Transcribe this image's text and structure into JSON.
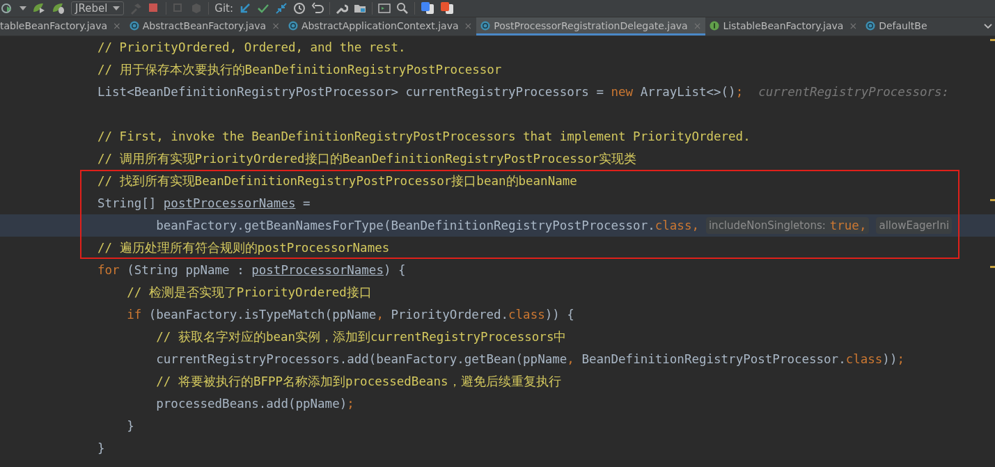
{
  "toolbar": {
    "vcs_profile": "JRebel",
    "git_label": "Git:"
  },
  "tabs": [
    {
      "label": "tableBeanFactory.java",
      "selected": false,
      "close": "×"
    },
    {
      "label": "AbstractBeanFactory.java",
      "kind": "class",
      "selected": false,
      "close": "×"
    },
    {
      "label": "AbstractApplicationContext.java",
      "kind": "class",
      "selected": false,
      "close": "×"
    },
    {
      "label": "PostProcessorRegistrationDelegate.java",
      "kind": "class",
      "selected": true,
      "close": "×"
    },
    {
      "label": "ListableBeanFactory.java",
      "kind": "interface",
      "selected": false,
      "close": "×"
    },
    {
      "label": "DefaultBe",
      "kind": "class",
      "selected": false
    }
  ],
  "lines": [
    {
      "current": false,
      "boxed": false,
      "segments": [
        {
          "kind": "comment",
          "text": "// PriorityOrdered, Ordered, and the rest."
        }
      ]
    },
    {
      "current": false,
      "boxed": false,
      "segments": [
        {
          "kind": "comment",
          "text": "// 用于保存本次要执行的BeanDefinitionRegistryPostProcessor"
        }
      ]
    },
    {
      "current": false,
      "boxed": false,
      "segments": [
        {
          "kind": "code",
          "text": "List<BeanDefinitionRegistryPostProcessor> currentRegistryProcessors = "
        },
        {
          "kind": "keyword",
          "text": "new"
        },
        {
          "kind": "code",
          "text": " ArrayList<>()"
        },
        {
          "kind": "keyword",
          "text": ";"
        },
        {
          "kind": "hint",
          "text": "currentRegistryProcessors:"
        }
      ]
    },
    {
      "current": false,
      "boxed": false
    },
    {
      "current": false,
      "boxed": false,
      "segments": [
        {
          "kind": "comment",
          "text": "// First, invoke the BeanDefinitionRegistryPostProcessors that implement PriorityOrdered."
        }
      ]
    },
    {
      "current": false,
      "boxed": false,
      "segments": [
        {
          "kind": "comment",
          "text": "// 调用所有实现PriorityOrdered接口的BeanDefinitionRegistryPostProcessor实现类"
        }
      ]
    },
    {
      "current": false,
      "boxed": true,
      "segments": [
        {
          "kind": "comment",
          "text": "// 找到所有实现BeanDefinitionRegistryPostProcessor接口bean的beanName"
        }
      ]
    },
    {
      "current": false,
      "boxed": true,
      "segments": [
        {
          "kind": "code",
          "text": "String[] "
        },
        {
          "kind": "field",
          "text": "postProcessorNames"
        },
        {
          "kind": "code",
          "text": " ="
        }
      ],
      "children": [
        {
          "kind": "continuation",
          "current": true,
          "boxed": true,
          "segments": [
            {
              "kind": "code",
              "text": "beanFactory.getBeanNamesForType(BeanDefinitionRegistryPostProcessor."
            },
            {
              "kind": "keyword",
              "text": "class,"
            },
            {
              "kind": "inlay",
              "text": "includeNonSingletons:",
              "value": "true,"
            },
            {
              "kind": "inlay",
              "text": "allowEagerIni"
            }
          ]
        }
      ]
    },
    {
      "current": false,
      "boxed": true,
      "segments": [
        {
          "kind": "comment",
          "text": "// 遍历处理所有符合规则的postProcessorNames"
        }
      ]
    },
    {
      "current": false,
      "boxed": false,
      "segments": [
        {
          "kind": "keyword",
          "text": "for"
        },
        {
          "kind": "code",
          "text": " (String ppName : "
        },
        {
          "kind": "field",
          "text": "postProcessorNames"
        },
        {
          "kind": "code",
          "text": ") {"
        }
      ],
      "children": [
        {
          "current": false,
          "boxed": false,
          "segments": [
            {
              "kind": "comment",
              "text": "// 检测是否实现了PriorityOrdered接口"
            }
          ]
        },
        {
          "current": false,
          "boxed": false,
          "segments": [
            {
              "kind": "keyword",
              "text": "if"
            },
            {
              "kind": "code",
              "text": " (beanFactory.isTypeMatch(ppName"
            },
            {
              "kind": "keyword",
              "text": ","
            },
            {
              "kind": "code",
              "text": " PriorityOrdered."
            },
            {
              "kind": "keyword",
              "text": "class"
            },
            {
              "kind": "code",
              "text": ")) {"
            }
          ],
          "children": [
            {
              "current": false,
              "boxed": false,
              "segments": [
                {
                  "kind": "comment",
                  "text": "// 获取名字对应的bean实例，添加到currentRegistryProcessors中"
                }
              ]
            },
            {
              "current": false,
              "boxed": false,
              "segments": [
                {
                  "kind": "code",
                  "text": "currentRegistryProcessors.add(beanFactory.getBean(ppName"
                },
                {
                  "kind": "keyword",
                  "text": ","
                },
                {
                  "kind": "code",
                  "text": " BeanDefinitionRegistryPostProcessor."
                },
                {
                  "kind": "keyword",
                  "text": "class"
                },
                {
                  "kind": "code",
                  "text": "))"
                },
                {
                  "kind": "keyword",
                  "text": ";"
                }
              ]
            },
            {
              "current": false,
              "boxed": false,
              "segments": [
                {
                  "kind": "comment",
                  "text": "// 将要被执行的BFPP名称添加到processedBeans，避免后续重复执行"
                }
              ]
            },
            {
              "current": false,
              "boxed": false,
              "segments": [
                {
                  "kind": "code",
                  "text": "processedBeans.add(ppName)"
                },
                {
                  "kind": "keyword",
                  "text": ";"
                }
              ]
            }
          ]
        },
        {
          "current": false,
          "boxed": false,
          "segments": [
            {
              "kind": "code",
              "text": "}"
            }
          ]
        }
      ]
    },
    {
      "current": false,
      "boxed": false,
      "segments": [
        {
          "kind": "code",
          "text": "}"
        }
      ]
    }
  ]
}
